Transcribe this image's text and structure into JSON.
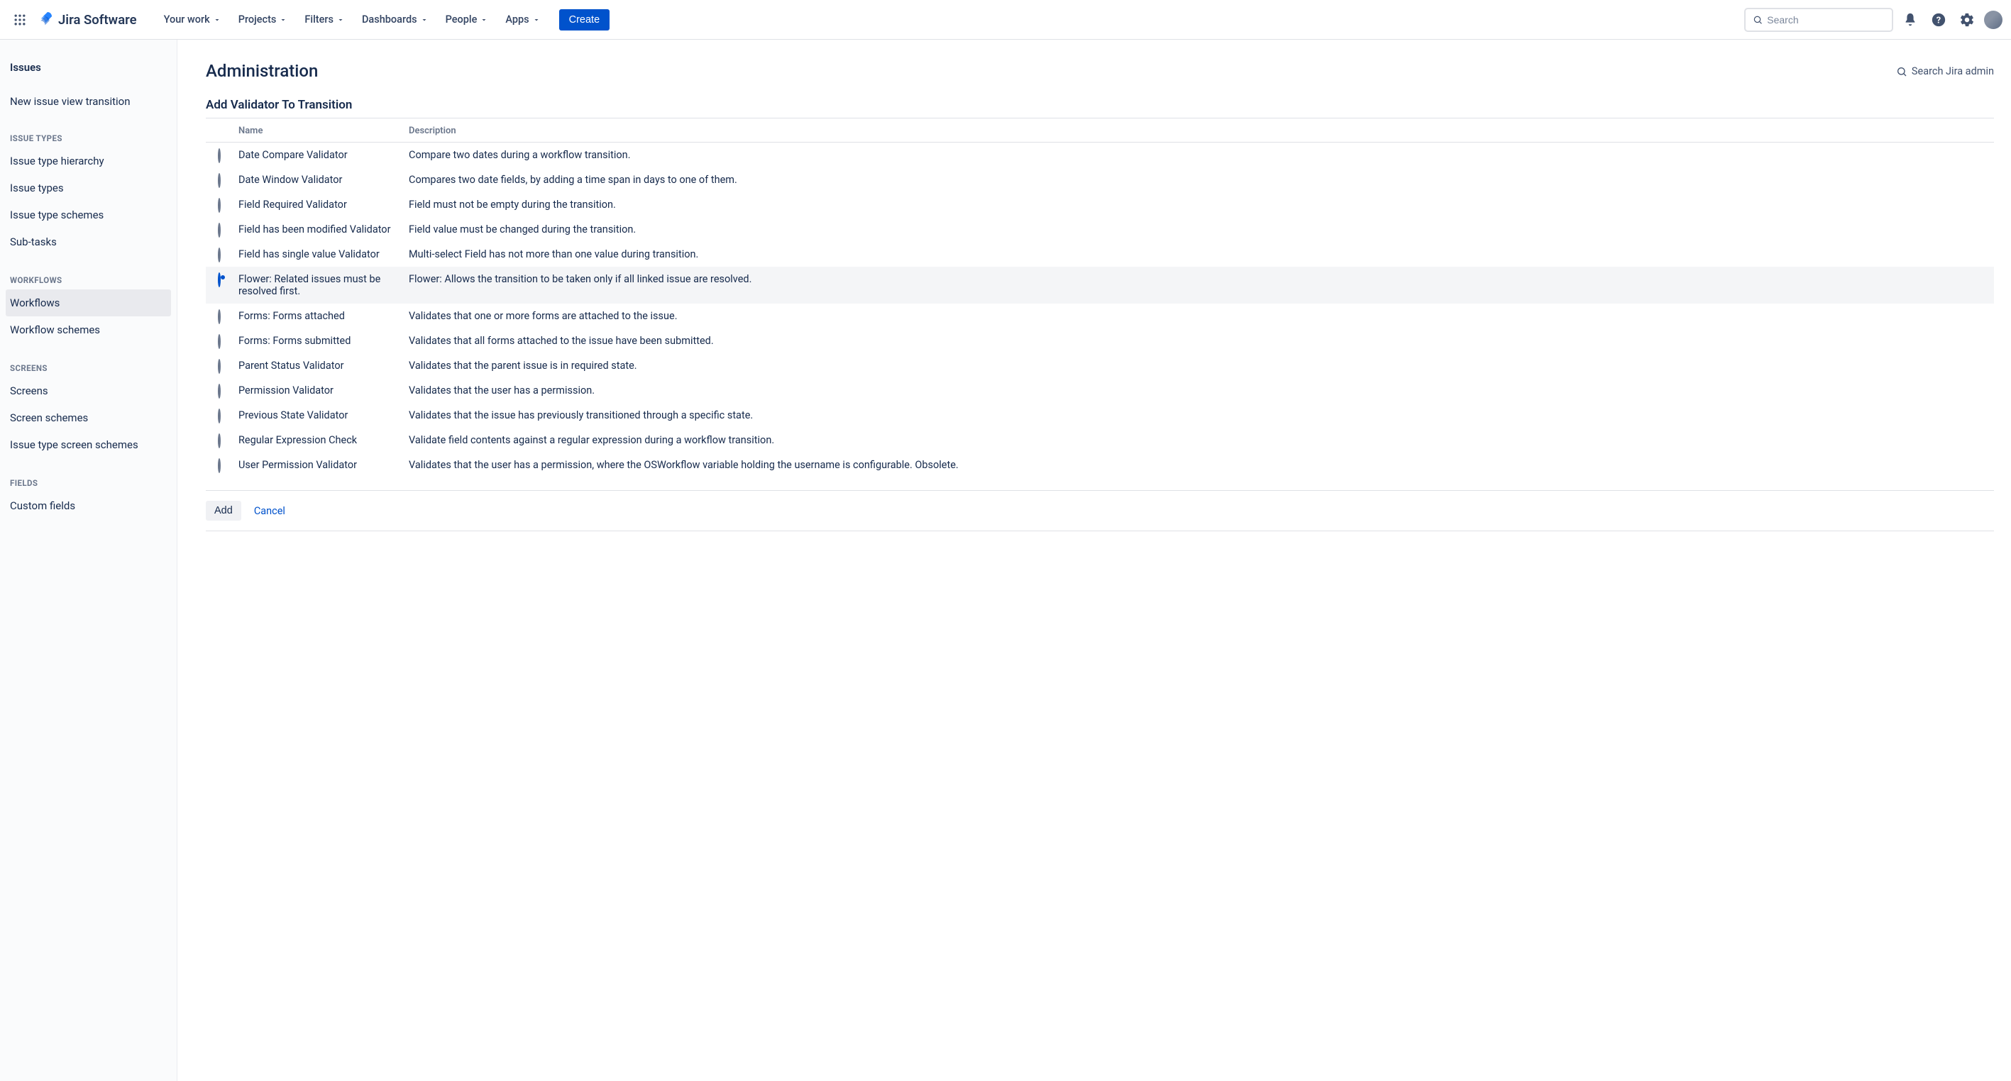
{
  "header": {
    "product_name": "Jira Software",
    "nav": [
      "Your work",
      "Projects",
      "Filters",
      "Dashboards",
      "People",
      "Apps"
    ],
    "create_label": "Create",
    "search_placeholder": "Search"
  },
  "sidebar": {
    "back_label": "Issues",
    "top_link": "New issue view transition",
    "groups": [
      {
        "title": "ISSUE TYPES",
        "items": [
          "Issue type hierarchy",
          "Issue types",
          "Issue type schemes",
          "Sub-tasks"
        ]
      },
      {
        "title": "WORKFLOWS",
        "items": [
          "Workflows",
          "Workflow schemes"
        ],
        "active_index": 0
      },
      {
        "title": "SCREENS",
        "items": [
          "Screens",
          "Screen schemes",
          "Issue type screen schemes"
        ]
      },
      {
        "title": "FIELDS",
        "items": [
          "Custom fields"
        ]
      }
    ]
  },
  "main": {
    "page_title": "Administration",
    "admin_search_label": "Search Jira admin",
    "section_title": "Add Validator To Transition",
    "columns": {
      "name": "Name",
      "description": "Description"
    },
    "selected_index": 5,
    "validators": [
      {
        "name": "Date Compare Validator",
        "description": "Compare two dates during a workflow transition."
      },
      {
        "name": "Date Window Validator",
        "description": "Compares two date fields, by adding a time span in days to one of them."
      },
      {
        "name": "Field Required Validator",
        "description": "Field must not be empty during the transition."
      },
      {
        "name": "Field has been modified Validator",
        "description": "Field value must be changed during the transition."
      },
      {
        "name": "Field has single value Validator",
        "description": "Multi-select Field has not more than one value during transition."
      },
      {
        "name": "Flower: Related issues must be resolved first.",
        "description": "Flower: Allows the transition to be taken only if all linked issue are resolved."
      },
      {
        "name": "Forms: Forms attached",
        "description": "Validates that one or more forms are attached to the issue."
      },
      {
        "name": "Forms: Forms submitted",
        "description": "Validates that all forms attached to the issue have been submitted."
      },
      {
        "name": "Parent Status Validator",
        "description": "Validates that the parent issue is in required state."
      },
      {
        "name": "Permission Validator",
        "description": "Validates that the user has a permission."
      },
      {
        "name": "Previous State Validator",
        "description": "Validates that the issue has previously transitioned through a specific state."
      },
      {
        "name": "Regular Expression Check",
        "description": "Validate field contents against a regular expression during a workflow transition."
      },
      {
        "name": "User Permission Validator",
        "description": "Validates that the user has a permission, where the OSWorkflow variable holding the username is configurable. Obsolete."
      }
    ],
    "buttons": {
      "add": "Add",
      "cancel": "Cancel"
    }
  }
}
